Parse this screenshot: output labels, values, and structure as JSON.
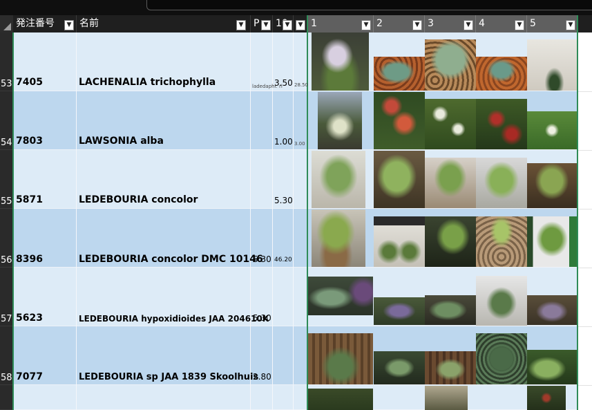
{
  "columns": {
    "order_no": "発注番号",
    "name": "名前",
    "p": "P",
    "col10": "10",
    "photo1": "1",
    "photo2": "2",
    "photo3": "3",
    "photo4": "4",
    "photo5": "5"
  },
  "rows": [
    {
      "row": "53",
      "code": "7405",
      "name": "LACHENALIA trichophylla",
      "p": "",
      "p_note": "ladedaphl. ri",
      "col10": "3.50",
      "extra": "28.50"
    },
    {
      "row": "54",
      "code": "7803",
      "name": "LAWSONIA alba",
      "p": "",
      "col10": "1.00",
      "extra": "3.00"
    },
    {
      "row": "55",
      "code": "5871",
      "name": "LEDEBOURIA concolor",
      "p": "",
      "col10": "5.30",
      "extra": ""
    },
    {
      "row": "56",
      "code": "8396",
      "name": "LEDEBOURIA concolor DMC 10146",
      "p": "5.30",
      "col10": "46.20",
      "extra": ""
    },
    {
      "row": "57",
      "code": "5623",
      "name": "LEDEBOURIA hypoxidioides JAA 204610K",
      "p": "5.30",
      "col10": "",
      "extra": ""
    },
    {
      "row": "58",
      "code": "7077",
      "name": "LEDEBOURIA sp JAA 1839 Skoolhuis",
      "p": "2.80",
      "col10": "",
      "extra": ""
    }
  ],
  "colors": {
    "row_light": "#ddebf7",
    "row_dark": "#bdd7ee",
    "header": "#1f1f1f",
    "photo_header": "#5f5f5f",
    "frame_border": "#2e8b57"
  },
  "icons": {
    "filter": "filter-dropdown-icon",
    "select_all": "select-all-corner-icon"
  }
}
